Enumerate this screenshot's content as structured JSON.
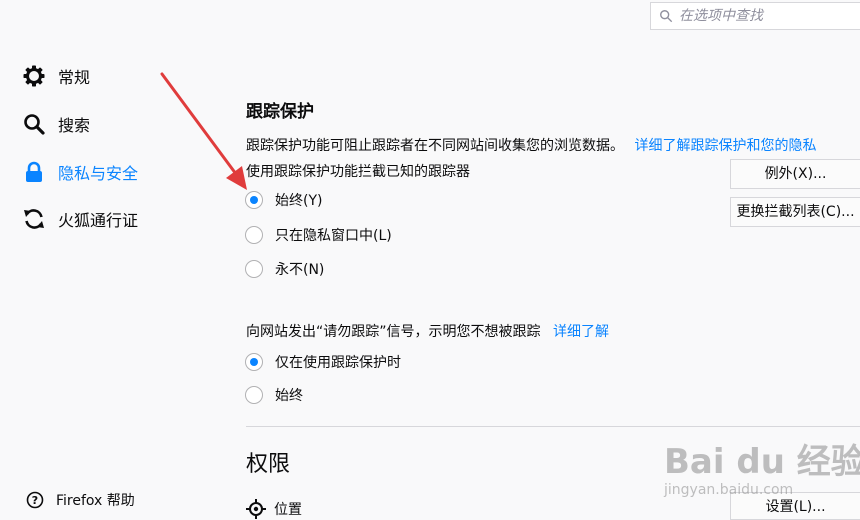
{
  "search": {
    "placeholder": "在选项中查找",
    "value": ""
  },
  "sidebar": {
    "items": [
      {
        "label": "常规",
        "icon": "gear-icon",
        "selected": false
      },
      {
        "label": "搜索",
        "icon": "search-icon",
        "selected": false
      },
      {
        "label": "隐私与安全",
        "icon": "lock-icon",
        "selected": true
      },
      {
        "label": "火狐通行证",
        "icon": "sync-icon",
        "selected": false
      }
    ],
    "help_label": "Firefox 帮助"
  },
  "tracking": {
    "heading": "跟踪保护",
    "description": "跟踪保护功能可阻止跟踪者在不同网站间收集您的浏览数据。",
    "learn_more_link": "详细了解跟踪保护和您的隐私",
    "subheading": "使用跟踪保护功能拦截已知的跟踪器",
    "options": [
      {
        "label": "始终(Y)",
        "checked": true
      },
      {
        "label": "只在隐私窗口中(L)",
        "checked": false
      },
      {
        "label": "永不(N)",
        "checked": false
      }
    ],
    "exceptions_button": "例外(X)...",
    "change_blocklist_button": "更换拦截列表(C)..."
  },
  "dnt": {
    "text": "向网站发出“请勿跟踪”信号，示明您不想被跟踪",
    "learn_more_link": "详细了解",
    "options": [
      {
        "label": "仅在使用跟踪保护时",
        "checked": true
      },
      {
        "label": "始终",
        "checked": false
      }
    ]
  },
  "permissions": {
    "heading": "权限",
    "location_label": "位置",
    "settings_button": "设置(L)..."
  },
  "watermark": {
    "main": "Bai du 经验",
    "sub": "jingyan.baidu.com"
  },
  "colors": {
    "accent": "#0a84ff",
    "arrow": "#e03c3c",
    "background": "#f9f9fa"
  }
}
